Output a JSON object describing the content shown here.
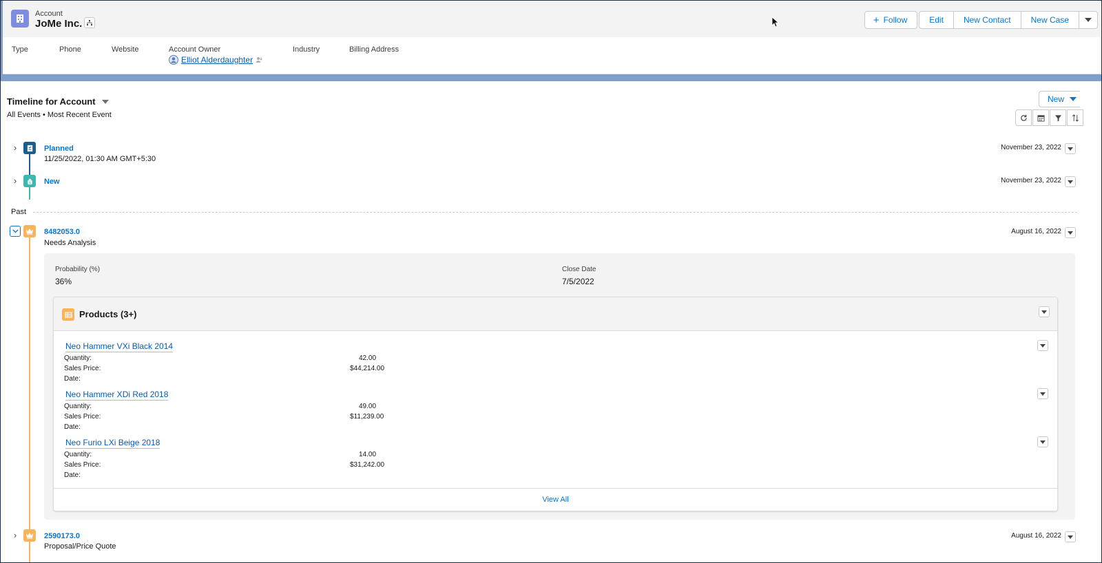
{
  "header": {
    "object_type": "Account",
    "account_name": "JoMe Inc.",
    "actions": {
      "follow": "Follow",
      "edit": "Edit",
      "new_contact": "New Contact",
      "new_case": "New Case"
    },
    "fields": {
      "type_label": "Type",
      "phone_label": "Phone",
      "website_label": "Website",
      "owner_label": "Account Owner",
      "owner_value": "Elliot Alderdaughter",
      "industry_label": "Industry",
      "billing_label": "Billing Address"
    }
  },
  "timeline": {
    "title": "Timeline for Account",
    "subtitle": "All Events • Most Recent Event",
    "new_label": "New",
    "upcoming": [
      {
        "title": "Planned",
        "subtitle": "11/25/2022, 01:30 AM GMT+5:30",
        "date": "November 23, 2022",
        "color": "#1b5e8c"
      },
      {
        "title": "New",
        "subtitle": "",
        "date": "November 23, 2022",
        "color": "#3bb8b0"
      }
    ],
    "past_label": "Past",
    "past": [
      {
        "title": "8482053.0",
        "subtitle": "Needs Analysis",
        "date": "August 16, 2022",
        "color": "#f9b359",
        "details": {
          "probability_label": "Probability (%)",
          "probability_value": "36%",
          "close_label": "Close Date",
          "close_value": "7/5/2022"
        },
        "products": {
          "title": "Products (3+)",
          "quantity_label": "Quantity:",
          "price_label": "Sales Price:",
          "date_label": "Date:",
          "items": [
            {
              "name": "Neo Hammer VXi Black 2014",
              "quantity": "42.00",
              "price": "$44,214.00"
            },
            {
              "name": "Neo Hammer XDi Red 2018",
              "quantity": "49.00",
              "price": "$11,239.00"
            },
            {
              "name": "Neo Furio LXi Beige 2018",
              "quantity": "14.00",
              "price": "$31,242.00"
            }
          ],
          "view_all": "View All"
        }
      },
      {
        "title": "2590173.0",
        "subtitle": "Proposal/Price Quote",
        "date": "August 16, 2022",
        "color": "#f9b359"
      }
    ]
  }
}
